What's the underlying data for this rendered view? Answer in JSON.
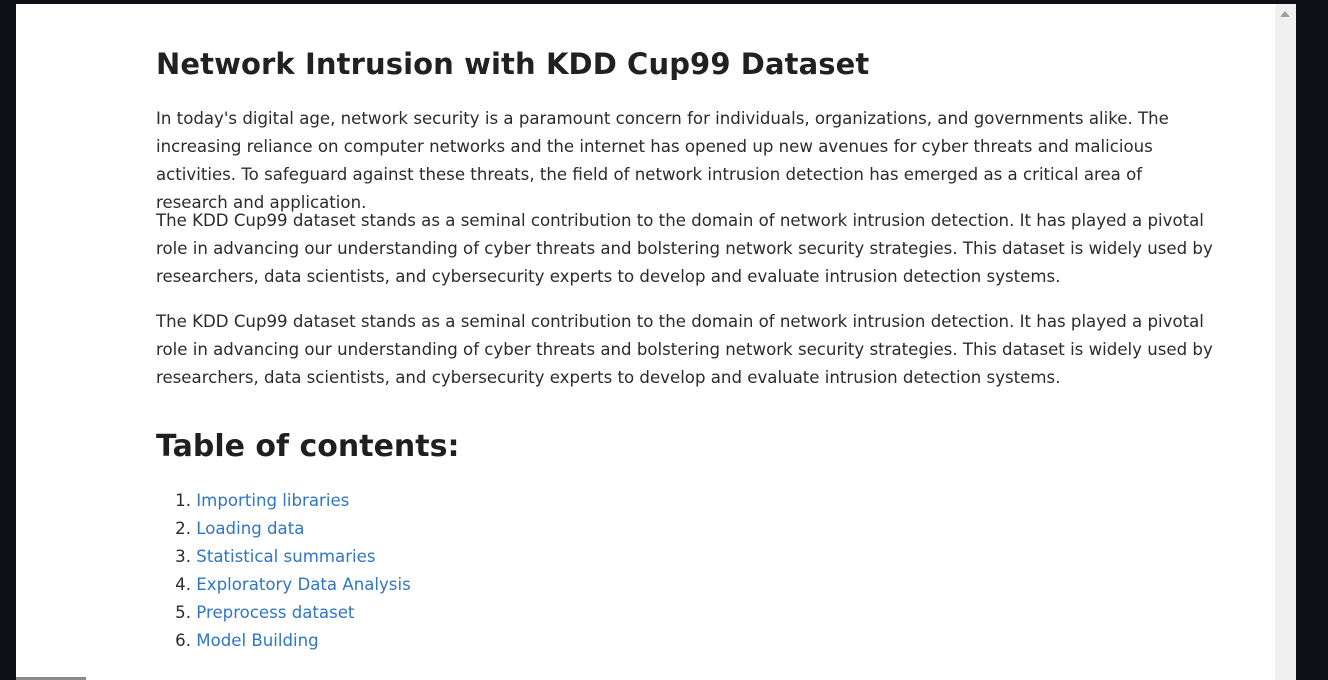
{
  "notebook": {
    "title": "Network Intrusion with KDD Cup99 Dataset",
    "paragraphs": [
      "In today's digital age, network security is a paramount concern for individuals, organizations, and governments alike. The increasing reliance on computer networks and the internet has opened up new avenues for cyber threats and malicious activities. To safeguard against these threats, the field of network intrusion detection has emerged as a critical area of research and application.",
      "The KDD Cup99 dataset stands as a seminal contribution to the domain of network intrusion detection. It has played a pivotal role in advancing our understanding of cyber threats and bolstering network security strategies. This dataset is widely used by researchers, data scientists, and cybersecurity experts to develop and evaluate intrusion detection systems.",
      "The KDD Cup99 dataset stands as a seminal contribution to the domain of network intrusion detection. It has played a pivotal role in advancing our understanding of cyber threats and bolstering network security strategies. This dataset is widely used by researchers, data scientists, and cybersecurity experts to develop and evaluate intrusion detection systems."
    ],
    "toc_heading": "Table of contents:",
    "toc": [
      {
        "num": "1.",
        "label": "Importing libraries"
      },
      {
        "num": "2.",
        "label": "Loading data"
      },
      {
        "num": "3.",
        "label": "Statistical summaries"
      },
      {
        "num": "4.",
        "label": "Exploratory Data Analysis"
      },
      {
        "num": "5.",
        "label": "Preprocess dataset"
      },
      {
        "num": "6.",
        "label": "Model Building"
      }
    ]
  },
  "colors": {
    "link": "#2f76c4",
    "text": "#2b2b2b",
    "background": "#ffffff",
    "chrome": "#0d1117"
  },
  "icons": {
    "scroll_up": "scroll-up-arrow-icon"
  }
}
